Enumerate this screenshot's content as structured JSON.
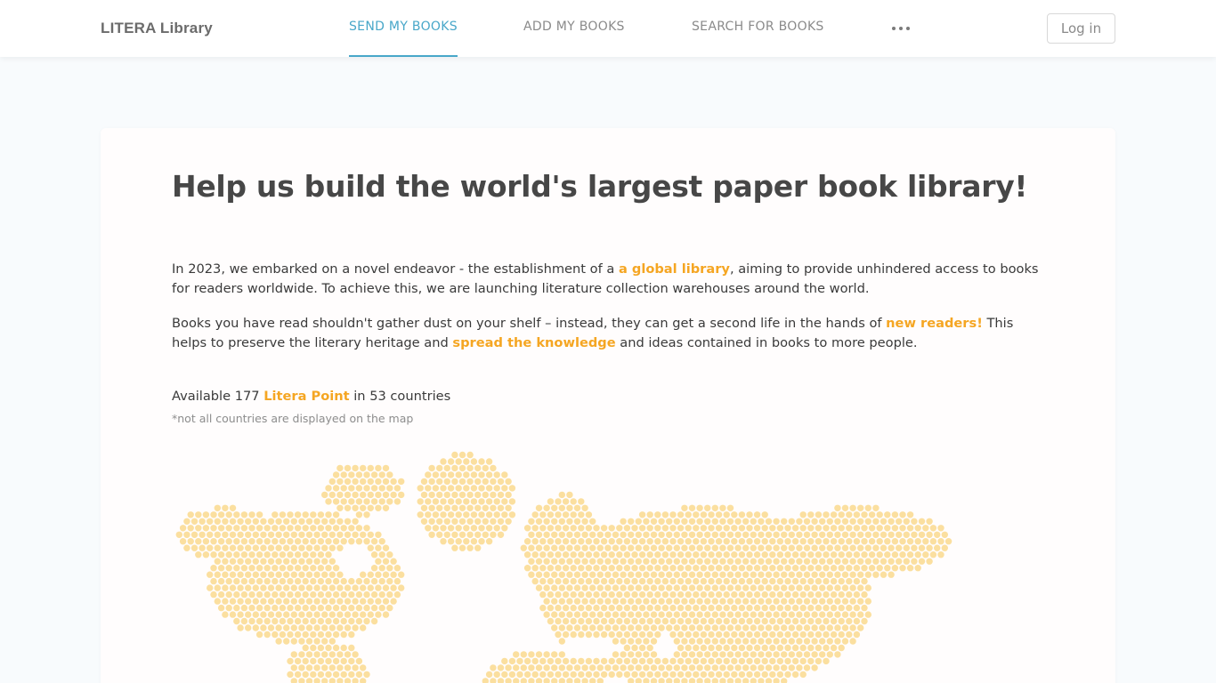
{
  "header": {
    "brand": "LITERA Library",
    "tabs": [
      {
        "label": "SEND MY BOOKS",
        "active": true
      },
      {
        "label": "ADD MY BOOKS",
        "active": false
      },
      {
        "label": "SEARCH FOR BOOKS",
        "active": false
      }
    ],
    "more_icon": "more-horizontal-icon",
    "login_label": "Log in"
  },
  "main": {
    "headline": "Help us build the world's largest paper book library!",
    "p1": {
      "before": "In 2023, we embarked on a novel endeavor - the establishment of a ",
      "link": "a global library",
      "after": ", aiming to provide unhindered access to books for readers worldwide. To achieve this, we are launching literature collection warehouses around the world."
    },
    "p2": {
      "before": "Books you have read shouldn't gather dust on your shelf – instead, they can get a second life in the hands of ",
      "link1": "new readers!",
      "middle": " This helps to preserve the literary heritage and ",
      "link2": "spread the knowledge",
      "after": " and ideas contained in books to more people."
    },
    "availability": {
      "before": "Available 177 ",
      "link": "Litera Point",
      "after": " in 53 countries"
    },
    "footnote": "*not all countries are displayed on the map"
  },
  "colors": {
    "accent_blue": "#48a7c9",
    "accent_orange": "#f5a623",
    "map_dot": "#fbdf9f"
  }
}
